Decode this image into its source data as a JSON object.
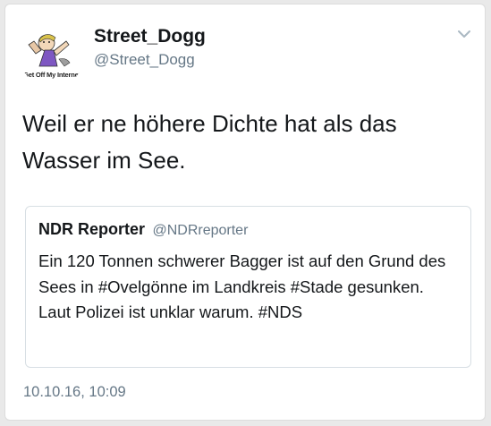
{
  "tweet": {
    "display_name": "Street_Dogg",
    "handle": "@Street_Dogg",
    "avatar_caption": "Get Off My Internet",
    "avatar_icon": "cartoon-avatar",
    "menu_icon": "chevron-down-icon",
    "text": "Weil er ne höhere Dichte hat als das Wasser im See.",
    "timestamp": "10.10.16, 10:09"
  },
  "quoted_tweet": {
    "display_name": "NDR Reporter",
    "handle": "@NDRreporter",
    "text": "Ein 120 Tonnen schwerer Bagger ist auf den Grund des Sees in #Ovelgönne im Landkreis #Stade gesunken. Laut Polizei ist unklar warum. #NDS"
  },
  "colors": {
    "text_primary": "#14171a",
    "text_secondary": "#657786",
    "border": "#d8dfe4",
    "background": "#e9e9e9"
  }
}
